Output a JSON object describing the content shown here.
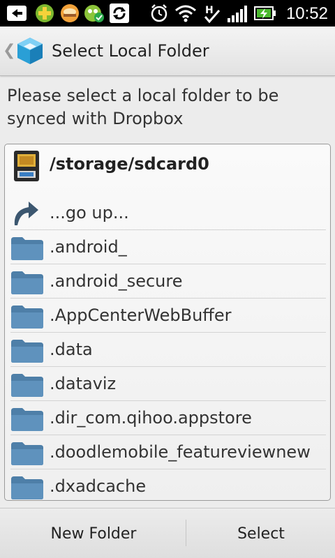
{
  "status_bar": {
    "time": "10:52",
    "icons": [
      "back-notify-icon",
      "plus-app-icon",
      "food-app-icon",
      "frog-app-icon",
      "sync-icon",
      "alarm-icon",
      "wifi-icon",
      "network-h-icon",
      "signal-icon",
      "battery-icon"
    ]
  },
  "action_bar": {
    "back_glyph": "❮",
    "title": "Select Local Folder"
  },
  "instruction": "Please select a local folder to be synced with Dropbox",
  "current_path": "/storage/sdcard0",
  "go_up_label": "...go up...",
  "folders": [
    ".android_",
    ".android_secure",
    ".AppCenterWebBuffer",
    ".data",
    ".dataviz",
    ".dir_com.qihoo.appstore",
    ".doodlemobile_featureviewnew",
    ".dxadcache"
  ],
  "buttons": {
    "new_folder": "New Folder",
    "select": "Select"
  },
  "colors": {
    "folder": "#4e7fa8",
    "accent": "#2a9fd6",
    "status_bar": "#000000"
  }
}
